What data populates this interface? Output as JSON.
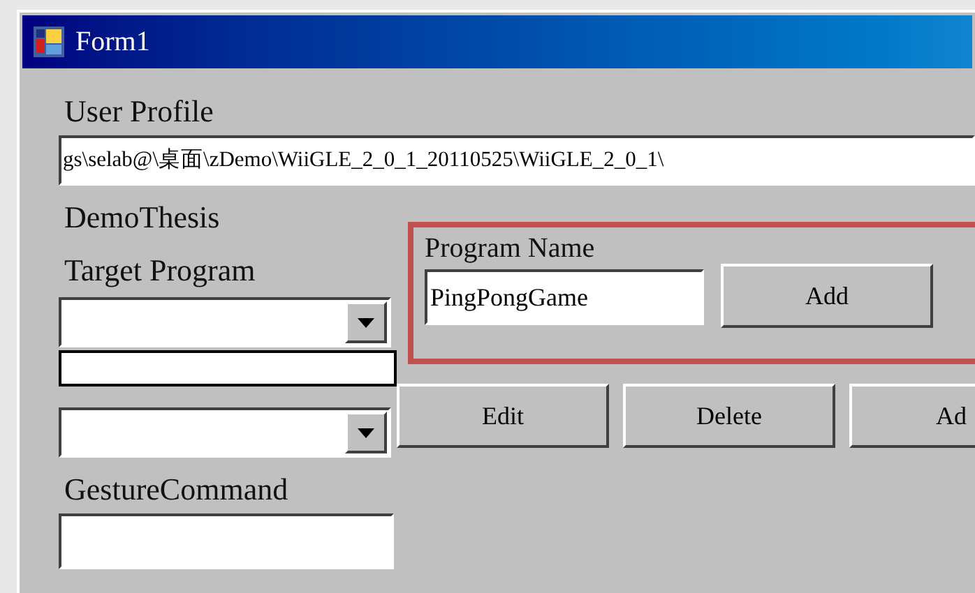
{
  "window": {
    "title": "Form1"
  },
  "user_profile": {
    "label": "User Profile",
    "value": "gs\\selab@\\桌面\\zDemo\\WiiGLE_2_0_1_20110525\\WiiGLE_2_0_1\\"
  },
  "profile_name": "DemoThesis",
  "target_program": {
    "label": "Target Program"
  },
  "gesture_command": {
    "label": "GestureCommand"
  },
  "program_name": {
    "label": "Program Name",
    "value": "PingPongGame",
    "button": "Add"
  },
  "buttons": [
    "Edit",
    "Delete",
    "Ad"
  ]
}
